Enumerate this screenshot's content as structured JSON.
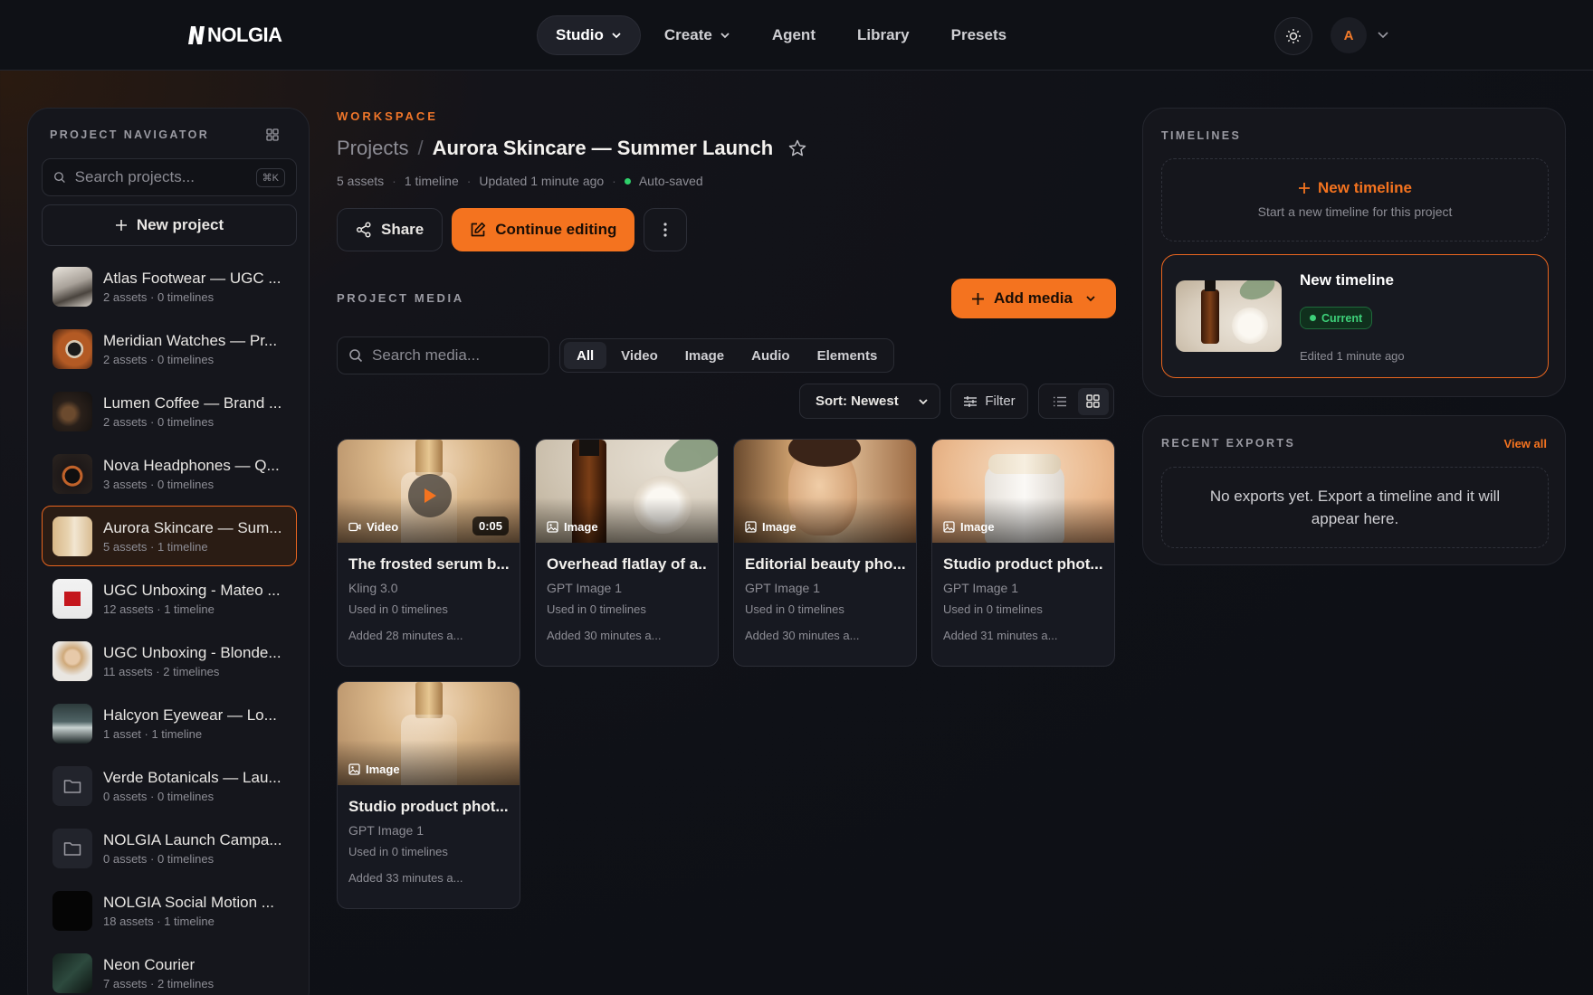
{
  "brand": {
    "name": "NOLGIA"
  },
  "nav": {
    "items": [
      {
        "label": "Studio",
        "has_menu": true,
        "active": true
      },
      {
        "label": "Create",
        "has_menu": true,
        "active": false
      },
      {
        "label": "Agent",
        "has_menu": false,
        "active": false
      },
      {
        "label": "Library",
        "has_menu": false,
        "active": false
      },
      {
        "label": "Presets",
        "has_menu": false,
        "active": false
      }
    ],
    "avatar_initial": "A",
    "theme_icon": "sun-icon"
  },
  "sidebar": {
    "title": "PROJECT NAVIGATOR",
    "search_placeholder": "Search projects...",
    "search_shortcut": "⌘K",
    "new_project_label": "New project",
    "projects": [
      {
        "name": "Atlas Footwear — UGC ...",
        "meta": "2 assets · 0 timelines"
      },
      {
        "name": "Meridian Watches — Pr...",
        "meta": "2 assets · 0 timelines"
      },
      {
        "name": "Lumen Coffee — Brand ...",
        "meta": "2 assets · 0 timelines"
      },
      {
        "name": "Nova Headphones — Q...",
        "meta": "3 assets · 0 timelines"
      },
      {
        "name": "Aurora Skincare — Sum...",
        "meta": "5 assets · 1 timeline",
        "active": true
      },
      {
        "name": "UGC Unboxing - Mateo ...",
        "meta": "12 assets · 1 timeline"
      },
      {
        "name": "UGC Unboxing - Blonde...",
        "meta": "11 assets · 2 timelines"
      },
      {
        "name": "Halcyon Eyewear — Lo...",
        "meta": "1 asset · 1 timeline"
      },
      {
        "name": "Verde Botanicals — Lau...",
        "meta": "0 assets · 0 timelines",
        "folder": true
      },
      {
        "name": "NOLGIA Launch Campa...",
        "meta": "0 assets · 0 timelines",
        "folder": true
      },
      {
        "name": "NOLGIA Social Motion ...",
        "meta": "18 assets · 1 timeline"
      },
      {
        "name": "Neon Courier",
        "meta": "7 assets · 2 timelines"
      }
    ]
  },
  "workspace": {
    "eyebrow": "WORKSPACE",
    "breadcrumb_root": "Projects",
    "breadcrumb_sep": "/",
    "project_title": "Aurora Skincare — Summer Launch",
    "meta": {
      "assets": "5 assets",
      "timelines": "1 timeline",
      "updated": "Updated 1 minute ago",
      "saved": "Auto-saved"
    },
    "share_label": "Share",
    "continue_label": "Continue editing"
  },
  "media": {
    "section_label": "PROJECT MEDIA",
    "add_label": "Add media",
    "search_placeholder": "Search media...",
    "filters": [
      "All",
      "Video",
      "Image",
      "Audio",
      "Elements"
    ],
    "active_filter": "All",
    "sort_label": "Sort: Newest",
    "filter_label": "Filter",
    "view_mode": "grid",
    "items": [
      {
        "type": "Video",
        "duration": "0:05",
        "title": "The frosted serum b...",
        "model": "Kling 3.0",
        "used": "Used in 0 timelines",
        "added": "Added 28 minutes a..."
      },
      {
        "type": "Image",
        "title": "Overhead flatlay of a...",
        "model": "GPT Image 1",
        "used": "Used in 0 timelines",
        "added": "Added 30 minutes a..."
      },
      {
        "type": "Image",
        "title": "Editorial beauty pho...",
        "model": "GPT Image 1",
        "used": "Used in 0 timelines",
        "added": "Added 30 minutes a..."
      },
      {
        "type": "Image",
        "title": "Studio product phot...",
        "model": "GPT Image 1",
        "used": "Used in 0 timelines",
        "added": "Added 31 minutes a..."
      },
      {
        "type": "Image",
        "title": "Studio product phot...",
        "model": "GPT Image 1",
        "used": "Used in 0 timelines",
        "added": "Added 33 minutes a..."
      }
    ]
  },
  "timelines": {
    "title": "TIMELINES",
    "new_label": "New timeline",
    "new_sub": "Start a new timeline for this project",
    "current": {
      "name": "New timeline",
      "badge": "Current",
      "edited": "Edited 1 minute ago"
    }
  },
  "exports": {
    "title": "RECENT EXPORTS",
    "view_all": "View all",
    "empty": "No exports yet. Export a timeline and it will appear here."
  },
  "colors": {
    "accent": "#f4731f",
    "success": "#3ed27a",
    "background": "#0f1117"
  }
}
